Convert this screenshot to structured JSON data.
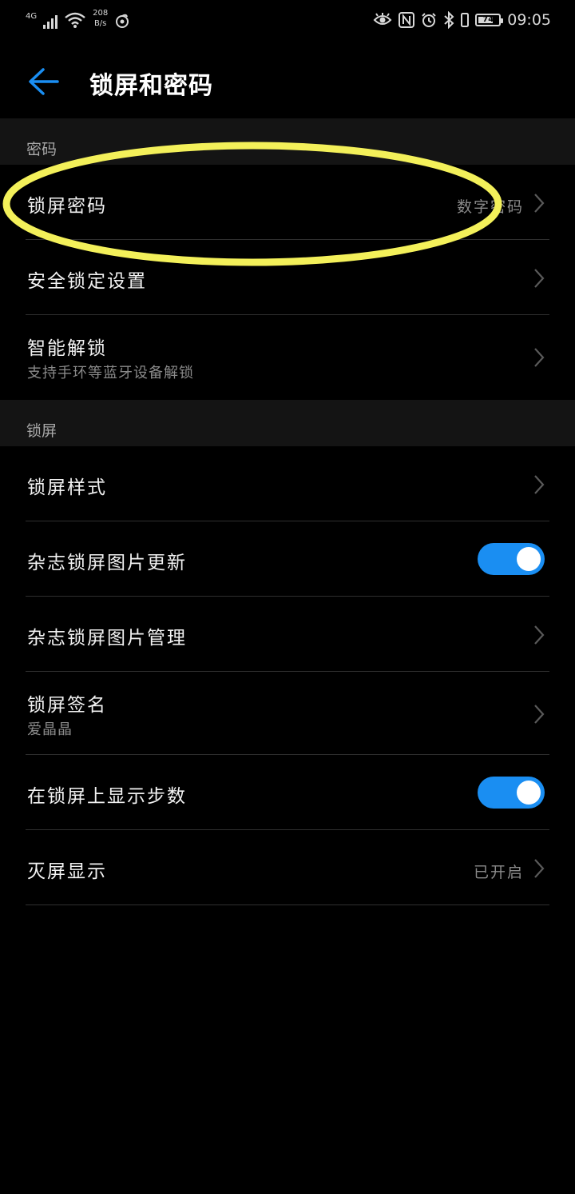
{
  "status_bar": {
    "network_type": "4G",
    "speed_value": "208",
    "speed_unit": "B/s",
    "battery_level": 74,
    "battery_text": "74",
    "time": "09:05"
  },
  "header": {
    "title": "锁屏和密码"
  },
  "sections": {
    "password": {
      "header": "密码",
      "rows": [
        {
          "title": "锁屏密码",
          "value": "数字密码"
        },
        {
          "title": "安全锁定设置"
        },
        {
          "title": "智能解锁",
          "subtitle": "支持手环等蓝牙设备解锁"
        }
      ]
    },
    "lockscreen": {
      "header": "锁屏",
      "rows": [
        {
          "title": "锁屏样式"
        },
        {
          "title": "杂志锁屏图片更新",
          "toggle_on": true
        },
        {
          "title": "杂志锁屏图片管理"
        },
        {
          "title": "锁屏签名",
          "subtitle": "爱晶晶"
        },
        {
          "title": "在锁屏上显示步数",
          "toggle_on": true
        },
        {
          "title": "灭屏显示",
          "value": "已开启"
        }
      ]
    }
  },
  "colors": {
    "background": "#000000",
    "section_header_bg": "#141414",
    "accent": "#1a8ef2",
    "annotation": "#f3f05a"
  }
}
